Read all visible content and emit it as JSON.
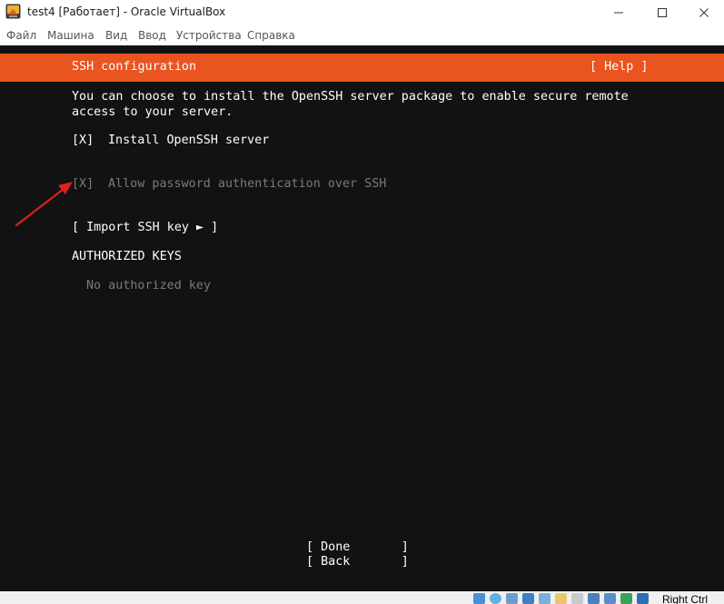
{
  "window": {
    "title": "test4 [Работает] - Oracle VirtualBox"
  },
  "menu": {
    "items": [
      "Файл",
      "Машина",
      "Вид",
      "Ввод",
      "Устройства",
      "Справка"
    ]
  },
  "installer": {
    "header_title": "SSH configuration",
    "help_label": "[ Help ]",
    "description_line1": "You can choose to install the OpenSSH server package to enable secure remote",
    "description_line2": "access to your server.",
    "install_checkbox": "[X]",
    "install_label": "Install OpenSSH server",
    "password_checkbox": "[X]",
    "password_label": "Allow password authentication over SSH",
    "import_key_label": "[ Import SSH key ► ]",
    "authorized_keys_heading": "AUTHORIZED KEYS",
    "no_keys_text": "No authorized key",
    "done_label": "[ Done       ]",
    "back_label": "[ Back       ]",
    "accent_color": "#e95420"
  },
  "statusbar": {
    "right_ctrl": "Right Ctrl",
    "icons": [
      "hard-disk-icon",
      "optical-drive-icon",
      "audio-icon",
      "network-icon",
      "usb-icon",
      "shared-folders-icon",
      "display-icon",
      "video-capture-icon",
      "cpu-icon",
      "mouse-integration-icon",
      "keyboard-icon"
    ]
  }
}
